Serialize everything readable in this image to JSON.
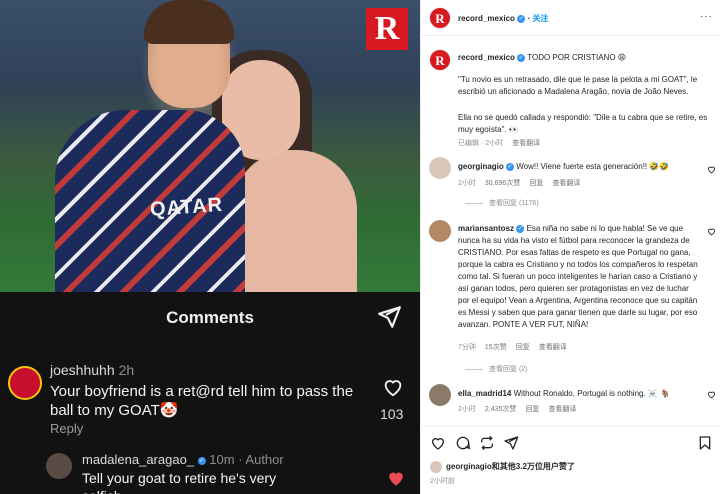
{
  "media": {
    "brand_logo": "R",
    "jersey_text": "QATAR",
    "sheet_title": "Comments",
    "comment1": {
      "username": "joeshhuhh",
      "time": "2h",
      "text": "Your boyfriend is a ret@rd tell him to pass the ball to my GOAT🤡",
      "reply_label": "Reply",
      "like_count": "103"
    },
    "comment2": {
      "username": "madalena_aragao_",
      "time_author": "10m · Author",
      "text": "Tell your goat to retire he's very selfish"
    }
  },
  "header": {
    "username": "record_mexico",
    "follow_label": "关注",
    "more": "···"
  },
  "caption": {
    "username": "record_mexico",
    "title": "TODO POR CRISTIANO 😩",
    "p1": "\"Tu novio es un retrasado, dile que le pase la pelota a mi GOAT\", le escribió un aficionado a Madalena Aragão, novia de João Neves.",
    "p2": "Ella no se quedó callada y respondió: \"Dile a tu cabra que se retire, es muy egoísta\". 👀",
    "edited": "已编辑 · 2小时",
    "translate": "查看翻译"
  },
  "comments": [
    {
      "username": "georginagio",
      "text": "Wow!! Viene fuerte esta generación!! 🤣🤣",
      "time": "2小时",
      "likes": "30,696次赞",
      "reply": "回复",
      "translate": "查看翻译",
      "view_replies": "查看回复 (1176)"
    },
    {
      "username": "mariansantosz",
      "text": "Esa niña no sabe ni lo que habla! Se ve que nunca ha su vida ha visto el fútbol para reconocer la grandeza de CRISTIANO. Por esas faltas de respeto es que Portugal no gana, porque la cabra es Cristiano y no todos los compañeros lo respetan como tal. Si fueran un poco inteligentes le harían caso a Cristiano y así ganan todos, pero quieren ser protagonistas en vez de luchar por el equipo! Vean a Argentina, Argentina reconoce que su capitán es Messi y saben que para ganar tienen que darle su lugar, por eso avanzan. PONTE A VER FUT, NIÑA!",
      "time": "7分钟",
      "likes": "15次赞",
      "reply": "回复",
      "translate": "查看翻译",
      "view_replies": "查看回复 (2)"
    },
    {
      "username": "ella_madrid14",
      "text": "Without Ronaldo, Portugal is nothing. ☠️ 🐐",
      "time": "2小时",
      "likes": "2,435次赞",
      "reply": "回复",
      "translate": "查看翻译"
    }
  ],
  "likes_line": {
    "user": "georginagio",
    "rest": "和其他3.2万位用户赞了",
    "time": "2小时前"
  },
  "colors": {
    "accent": "#0095f6",
    "brand": "#d71920",
    "verified": "#3897f0"
  }
}
